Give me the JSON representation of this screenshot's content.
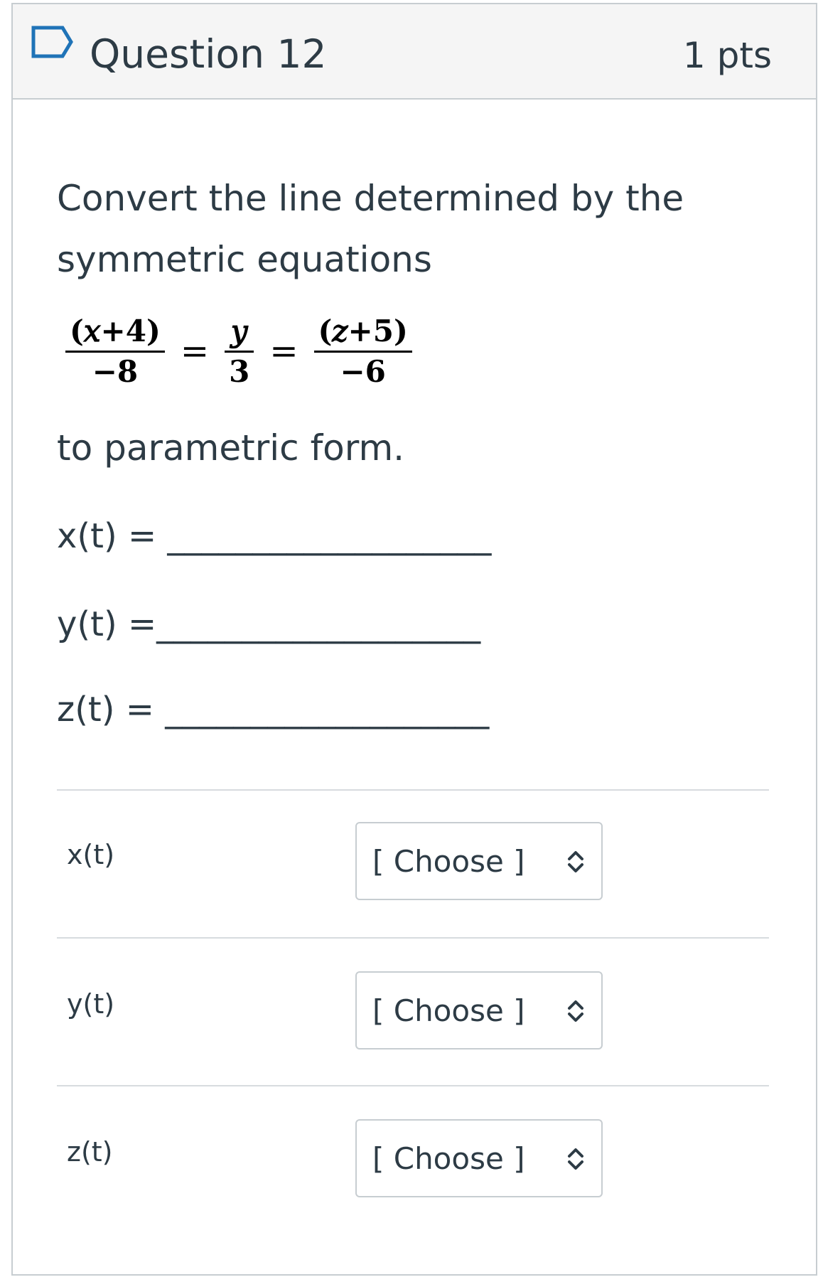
{
  "question": {
    "title": "Question 12",
    "points": "1 pts",
    "prompt": "Convert the line determined by the symmetric equations",
    "equation": {
      "frac1_num": "(𝑥+4)",
      "frac1_den": "−8",
      "frac2_num": "𝑦",
      "frac2_den": "3",
      "frac3_num": "(𝑧+5)",
      "frac3_den": "−6",
      "equals": "="
    },
    "suffix": "to parametric form.",
    "blanks": [
      "x(t) = ___________________",
      "y(t) =___________________",
      "z(t) = ___________________"
    ]
  },
  "matching": [
    {
      "label": "x(t)",
      "selected": "[ Choose ]"
    },
    {
      "label": "y(t)",
      "selected": "[ Choose ]"
    },
    {
      "label": "z(t)",
      "selected": "[ Choose ]"
    }
  ],
  "icons": {
    "flag": "bookmark-flag-icon",
    "select": "chevron-up-down-icon"
  },
  "colors": {
    "text": "#2d3b45",
    "border": "#c7cdd1",
    "header_bg": "#f5f5f5",
    "flag_stroke": "#1f73b7"
  }
}
